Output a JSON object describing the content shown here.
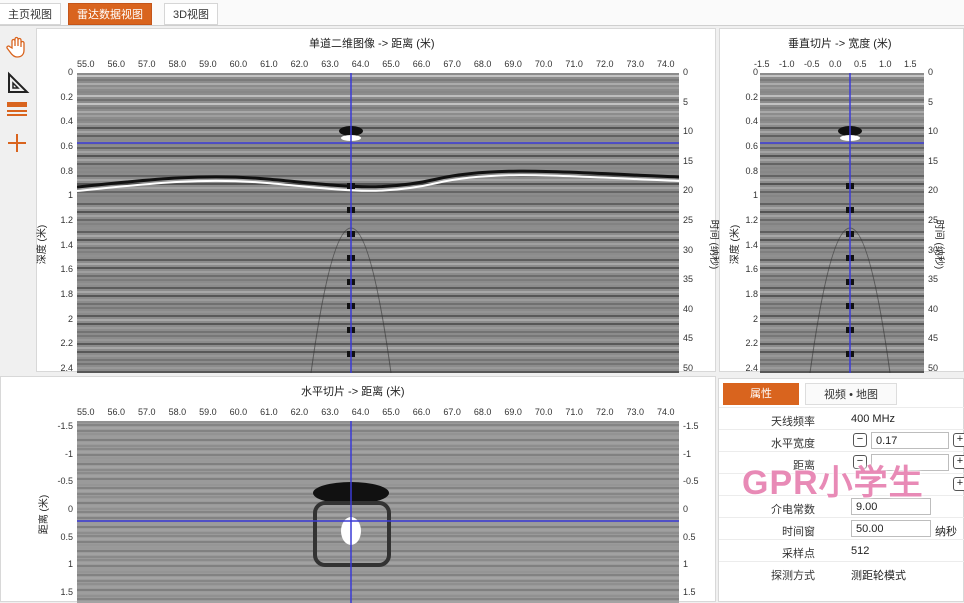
{
  "tabs": [
    {
      "label": "主页视图",
      "active": false
    },
    {
      "label": "雷达数据视图",
      "active": true
    },
    {
      "label": "3D视图",
      "active": false
    }
  ],
  "toolbar": {
    "icons": [
      "hand-icon",
      "ruler-triangle-icon",
      "layers-icon",
      "crosshair-icon"
    ]
  },
  "main_view": {
    "title": "单道二维图像 -> 距离 (米)",
    "x_ticks": [
      "55.0",
      "56.0",
      "57.0",
      "58.0",
      "59.0",
      "60.0",
      "61.0",
      "62.0",
      "63.0",
      "64.0",
      "65.0",
      "66.0",
      "67.0",
      "68.0",
      "69.0",
      "70.0",
      "71.0",
      "72.0",
      "73.0",
      "74.0"
    ],
    "y_ticks": [
      "0",
      "0.2",
      "0.4",
      "0.6",
      "0.8",
      "1",
      "1.2",
      "1.4",
      "1.6",
      "1.8",
      "2",
      "2.2",
      "2.4"
    ],
    "y2_ticks": [
      "0",
      "5",
      "10",
      "15",
      "20",
      "25",
      "30",
      "35",
      "40",
      "45",
      "50"
    ],
    "ylabel": "深度 (米)",
    "y2label": "时间 (纳秒)"
  },
  "vertical_slice": {
    "title": "垂直切片 -> 宽度 (米)",
    "x_ticks": [
      "-1.5",
      "-1.0",
      "-0.5",
      "0.0",
      "0.5",
      "1.0",
      "1.5"
    ],
    "y_ticks": [
      "0",
      "0.2",
      "0.4",
      "0.6",
      "0.8",
      "1",
      "1.2",
      "1.4",
      "1.6",
      "1.8",
      "2",
      "2.2",
      "2.4"
    ],
    "y2_ticks": [
      "0",
      "5",
      "10",
      "15",
      "20",
      "25",
      "30",
      "35",
      "40",
      "45",
      "50"
    ],
    "ylabel": "深度 (米)",
    "y2label": "时间 (纳秒)"
  },
  "horizontal_slice": {
    "title": "水平切片 -> 距离 (米)",
    "x_ticks": [
      "55.0",
      "56.0",
      "57.0",
      "58.0",
      "59.0",
      "60.0",
      "61.0",
      "62.0",
      "63.0",
      "64.0",
      "65.0",
      "66.0",
      "67.0",
      "68.0",
      "69.0",
      "70.0",
      "71.0",
      "72.0",
      "73.0",
      "74.0"
    ],
    "y_ticks": [
      "-1.5",
      "-1",
      "-0.5",
      "0",
      "0.5",
      "1",
      "1.5"
    ],
    "y2_ticks": [
      "-1.5",
      "-1",
      "-0.5",
      "0",
      "0.5",
      "1",
      "1.5"
    ],
    "ylabel": "距离 (米)"
  },
  "properties": {
    "tab_active": "属性",
    "tab_other": "视频 • 地图",
    "rows": {
      "freq_label": "天线频率",
      "freq_value": "400 MHz",
      "width_label": "水平宽度",
      "width_value": "0.17",
      "dist_label": "距离",
      "dielectric_label": "介电常数",
      "dielectric_value": "9.00",
      "window_label": "时间窗",
      "window_value": "50.00",
      "window_unit": "纳秒",
      "samples_label": "采样点",
      "samples_value": "512",
      "mode_label": "探测方式",
      "mode_value": "测距轮模式"
    },
    "minus": "−",
    "plus": "+"
  },
  "watermark": "GPR小学生",
  "colors": {
    "accent": "#d9641e",
    "crosshair": "#3b3bd6"
  }
}
